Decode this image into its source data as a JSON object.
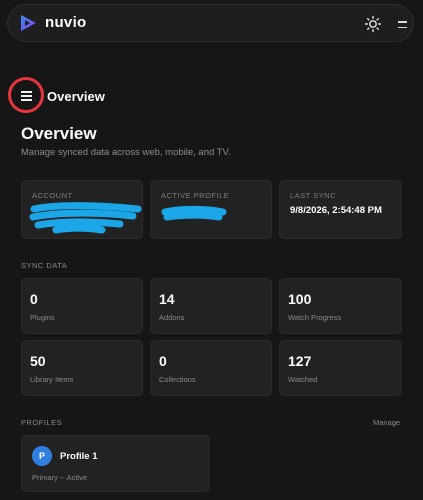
{
  "app": {
    "name": "nuvio"
  },
  "icons": {
    "logo": "nuvio-logo-icon",
    "theme": "sun-icon",
    "menu": "menu-icon"
  },
  "colors": {
    "background": "#161616",
    "card": "#222222",
    "highlight": "#e8343c",
    "scribble": "#1ba6e8",
    "avatar": "#2f7fe0"
  },
  "breadcrumb": {
    "label": "Overview"
  },
  "page": {
    "title": "Overview",
    "subtitle": "Manage synced data across web, mobile, and TV."
  },
  "info_cards": {
    "account": {
      "label": "ACCOUNT",
      "value": ""
    },
    "active_profile": {
      "label": "ACTIVE PROFILE",
      "value": ""
    },
    "last_sync": {
      "label": "LAST SYNC",
      "value": "9/8/2026, 2:54:48 PM"
    }
  },
  "sync": {
    "section_label": "SYNC DATA",
    "stats": [
      {
        "value": "0",
        "label": "Plugins"
      },
      {
        "value": "14",
        "label": "Addons"
      },
      {
        "value": "100",
        "label": "Watch Progress"
      },
      {
        "value": "50",
        "label": "Library Items"
      },
      {
        "value": "0",
        "label": "Collections"
      },
      {
        "value": "127",
        "label": "Watched"
      }
    ]
  },
  "profiles": {
    "section_label": "PROFILES",
    "manage_label": "Manage",
    "items": [
      {
        "initial": "P",
        "name": "Profile 1",
        "status": "Primary -- Active"
      }
    ]
  }
}
